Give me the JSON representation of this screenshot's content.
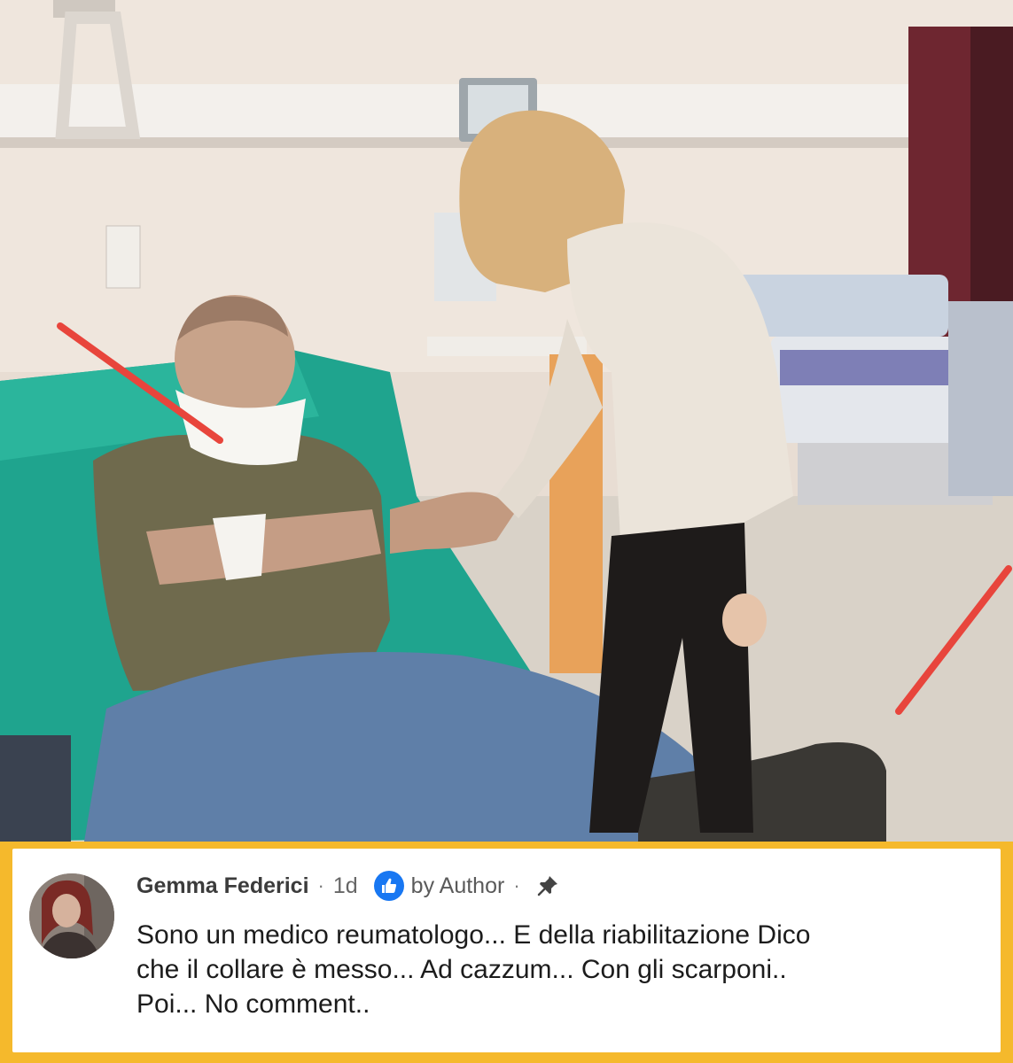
{
  "comment": {
    "author": "Gemma Federici",
    "separator": "·",
    "time": "1d",
    "author_badge": "by Author",
    "separator_2": "·",
    "text_lines": [
      "Sono un medico reumatologo... E della riabilitazione Dico",
      "che il collare è messo... Ad cazzum... Con gli scarponi..",
      "Poi... No comment.."
    ],
    "icons": {
      "like": "thumbs-up-icon",
      "pin": "pin-icon"
    }
  },
  "colors": {
    "frame": "#f5b92c",
    "arrow": "#e8453c",
    "like_badge": "#1877f2"
  }
}
